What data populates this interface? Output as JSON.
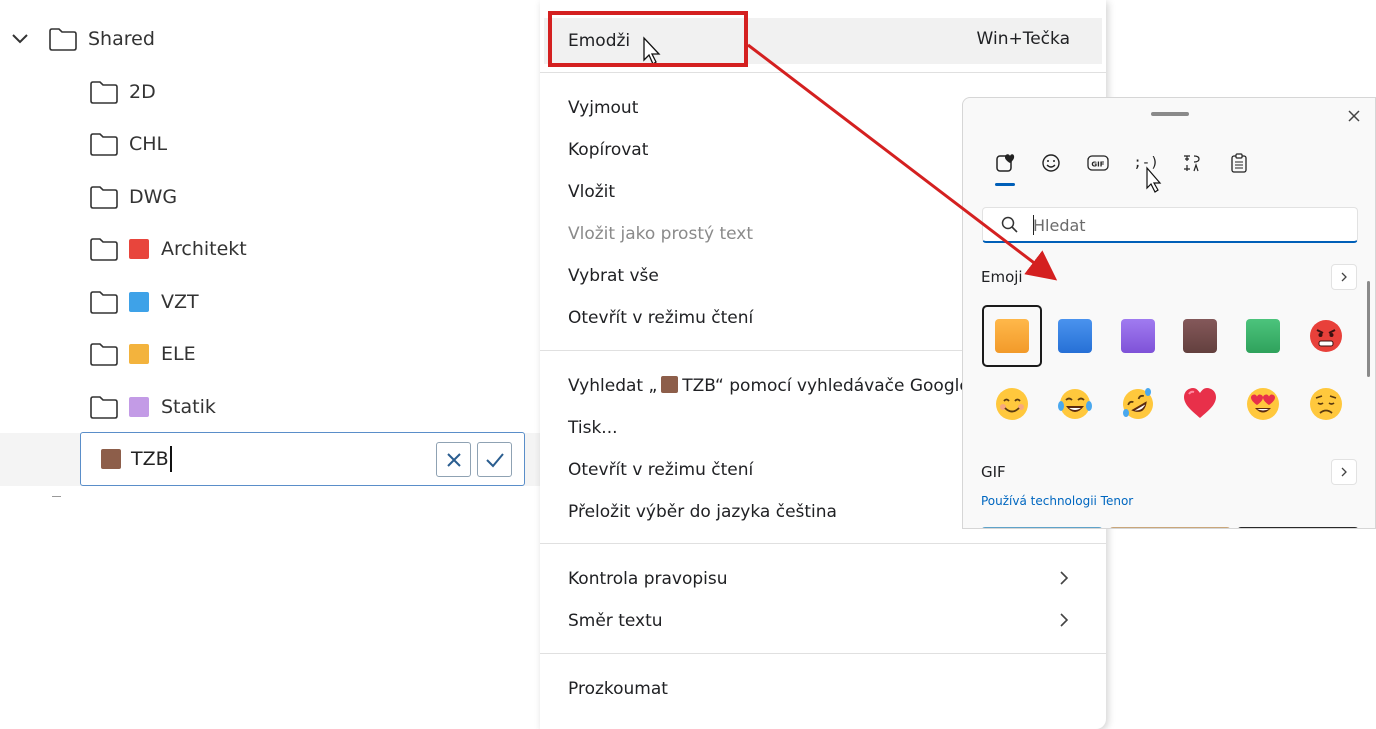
{
  "tree": {
    "root": {
      "label": "Shared"
    },
    "folders": [
      {
        "label": "2D",
        "color": ""
      },
      {
        "label": "CHL",
        "color": ""
      },
      {
        "label": "DWG",
        "color": ""
      },
      {
        "label": "Architekt",
        "color": "#e8453c"
      },
      {
        "label": "VZT",
        "color": "#3ea2e8"
      },
      {
        "label": "ELE",
        "color": "#f3b33d"
      },
      {
        "label": "Statik",
        "color": "#c39be6"
      }
    ],
    "edit": {
      "value": "TZB",
      "color": "#8d5e4a"
    }
  },
  "menu": {
    "emoji": {
      "label": "Emodži",
      "shortcut": "Win+Tečka"
    },
    "group1": [
      "Vyjmout",
      "Kopírovat",
      "Vložit",
      "Vložit jako prostý text",
      "Vybrat vše",
      "Otevřít v režimu čtení"
    ],
    "group2": {
      "search_prefix": "Vyhledat „",
      "search_term": "TZB",
      "search_suffix": "“ pomocí vyhledávače Google",
      "items": [
        "Tisk...",
        "Otevřít v režimu čtení",
        "Přeložit výběr do jazyka čeština"
      ]
    },
    "group3": [
      "Kontrola pravopisu",
      "Směr textu"
    ],
    "group4": [
      "Prozkoumat"
    ]
  },
  "annotation": {
    "color": "#d42020"
  },
  "emoji_panel": {
    "tabs": [
      "heart-emoji-icon",
      "smiley-icon",
      "gif-icon",
      "kaomoji-icon",
      "symbols-icon",
      "clipboard-icon"
    ],
    "tab_labels": {
      "gif": "GIF",
      "kaomoji": ";-)"
    },
    "search_placeholder": "Hledat",
    "section_emoji": "Emoji",
    "section_gif": "GIF",
    "tenor": "Používá technologii Tenor",
    "squares": [
      "#f4a233",
      "#2f7de1",
      "#8d5fe0",
      "#6e4a45",
      "#3db36a"
    ],
    "faces": [
      "angry-face",
      "smiling-face",
      "tears-of-joy-face",
      "rolling-laughing-face",
      "red-heart",
      "heart-eyes-face",
      "worried-face"
    ]
  },
  "accent": "#005fb8"
}
